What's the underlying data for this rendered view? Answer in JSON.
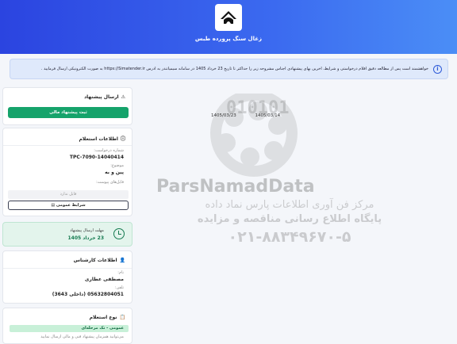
{
  "header": {
    "title": "زغال سنگ پرورده طبس"
  },
  "notice": {
    "text": "خواهشمند است پس از مطالعه دقیق اقلام درخواستی و شرایط، آخرین بهای پیشنهادی اجناس مشروحه زیر را حداکثر تا تاریخ 23 خرداد 1405 در سامانه سیمیاتندر به آدرس https://Simatender.ir به صورت الکترونیکی ارسال فرمایید ."
  },
  "offer_card": {
    "title": "ارسال پیشنهاد",
    "button": "ثبت پیشنهاد مالی"
  },
  "inquiry_card": {
    "title": "اطلاعات استعلام",
    "request_no_label": "شماره درخواست:",
    "request_no": "TPC-7090-14040414",
    "subject_label": "موضوع:",
    "subject": "پین و به",
    "attachments_label": "فایل‌های پیوست:",
    "no_file": "فایل ندارد",
    "general_terms": "شرایط عمومی"
  },
  "deadline": {
    "label": "مهلت ارسال پیشنهاد",
    "value": "23 خرداد 1405"
  },
  "expert_card": {
    "title": "اطلاعات کارشناس",
    "name_label": "نام:",
    "name": "مصطفی عطاری",
    "phone_label": "تلفن:",
    "phone": "05632804051 (داخلی 3643)"
  },
  "type_card": {
    "title": "نوع استعلام",
    "badge": "عمومی - تک مرحله‌ای",
    "note": "می‌توانید همزمان پیشنهاد فنی و مالی ارسال نمایید"
  },
  "dates": [
    "1405/03/23",
    "1405/03/14"
  ],
  "watermark": {
    "digits": "010101",
    "brand": "ParsNamadData",
    "line1": "مرکز فن آوری اطلاعات پارس نماد داده",
    "line2": "پایگاه اطلاع رسانی مناقصه و مزایده",
    "phone": "۰۲۱-۸۸۳۴۹۶۷۰-۵"
  },
  "colors": {
    "header_start": "#2b44e0",
    "header_end": "#4b8ef6",
    "primary_green": "#15a36b",
    "notice_bg": "#dfe9fb"
  }
}
